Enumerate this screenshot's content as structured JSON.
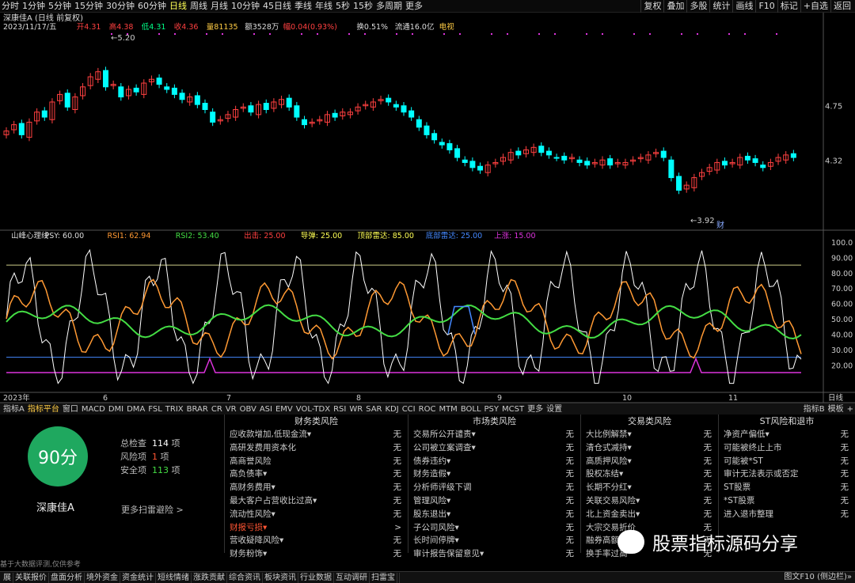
{
  "periods": [
    "分时",
    "1分钟",
    "5分钟",
    "15分钟",
    "30分钟",
    "60分钟",
    "日线",
    "周线",
    "月线",
    "10分钟",
    "45日线",
    "季线",
    "年线",
    "5秒",
    "15秒",
    "多周期",
    "更多"
  ],
  "active_period": "日线",
  "toolbar_right": [
    "复权",
    "叠加",
    "多股",
    "统计",
    "画线",
    "F10",
    "标记",
    "+自选",
    "返回"
  ],
  "stock_title": "深康佳A (日线 前复权)",
  "price_info": {
    "date": "2023/11/17/五",
    "open": "开4.31",
    "high": "高4.38",
    "low": "低4.31",
    "close": "收4.36",
    "vol": "量81135",
    "amount": "额3528万",
    "change": "幅0.04(0.93%)",
    "turnover": "换0.51%",
    "float": "流通16.0亿",
    "industry": "电视"
  },
  "price_axis": [
    "4.75",
    "4.32"
  ],
  "hi_label": "5.20",
  "lo_label": "3.92",
  "cai_label": "财",
  "indicator_header": {
    "name": "山峰心理线",
    "psy": "PSY: 60.00",
    "rsi1": "RSI1: 62.94",
    "rsi2": "RSI2: 53.40",
    "chuhuo": "出击: 25.00",
    "daoshu": "导弹: 25.00",
    "dingbu": "顶部雷达: 85.00",
    "dibu": "底部雷达: 25.00",
    "shangzhang": "上涨: 15.00"
  },
  "ind_axis": [
    "100.0",
    "90.00",
    "80.00",
    "70.00",
    "60.00",
    "50.00",
    "40.00",
    "30.00",
    "20.00"
  ],
  "date_axis": [
    "2023年",
    "6",
    "7",
    "8",
    "9",
    "10",
    "11",
    "日线"
  ],
  "tabs": [
    "指标A",
    "指标平台",
    "窗口",
    "MACD",
    "DMI",
    "DMA",
    "FSL",
    "TRIX",
    "BRAR",
    "CR",
    "VR",
    "OBV",
    "ASI",
    "EMV",
    "VOL-TDX",
    "RSI",
    "WR",
    "SAR",
    "KDJ",
    "CCI",
    "ROC",
    "MTM",
    "BOLL",
    "PSY",
    "MCST",
    "更多",
    "设置"
  ],
  "tabs_right": [
    "指标B",
    "模板",
    "+"
  ],
  "score": "90分",
  "stock_name": "深康佳A",
  "stats": {
    "total_label": "总检查",
    "total": "114",
    "total_unit": "项",
    "risk_label": "风险项",
    "risk": "1",
    "risk_unit": "项",
    "safe_label": "安全项",
    "safe": "113",
    "safe_unit": "项"
  },
  "more_scan": "更多扫雷避险 >",
  "columns": [
    {
      "title": "财务类风险",
      "rows": [
        [
          "应收款增加,低现金流▾",
          "无"
        ],
        [
          "高研发费用资本化",
          "无"
        ],
        [
          "高商誉风险",
          "无"
        ],
        [
          "高负债率▾",
          "无"
        ],
        [
          "高财务费用▾",
          "无"
        ],
        [
          "最大客户占营收比过高▾",
          "无"
        ],
        [
          "流动性风险▾",
          "无"
        ],
        [
          "财报亏损▾",
          ">"
        ],
        [
          "营收疑降风险▾",
          "无"
        ],
        [
          "财务粉饰▾",
          "无"
        ]
      ]
    },
    {
      "title": "市场类风险",
      "rows": [
        [
          "交易所公开谴责▾",
          "无"
        ],
        [
          "公司被立案调查▾",
          "无"
        ],
        [
          "债券违约▾",
          "无"
        ],
        [
          "财务造假▾",
          "无"
        ],
        [
          "分析师评级下调",
          "无"
        ],
        [
          "管理风险▾",
          "无"
        ],
        [
          "股东退出▾",
          "无"
        ],
        [
          "子公司风险▾",
          "无"
        ],
        [
          "长时间停牌▾",
          "无"
        ],
        [
          "审计报告保留意见▾",
          "无"
        ]
      ]
    },
    {
      "title": "交易类风险",
      "rows": [
        [
          "大比例解禁▾",
          "无"
        ],
        [
          "清仓式减持▾",
          "无"
        ],
        [
          "高质押风险▾",
          "无"
        ],
        [
          "股权冻结▾",
          "无"
        ],
        [
          "长期不分红▾",
          "无"
        ],
        [
          "关联交易风险▾",
          "无"
        ],
        [
          "北上资金卖出▾",
          "无"
        ],
        [
          "大宗交易折价",
          "无"
        ],
        [
          "融券高额",
          "无"
        ],
        [
          "换手率过高",
          "无"
        ]
      ]
    },
    {
      "title": "ST风险和退市",
      "rows": [
        [
          "净资产偏低▾",
          "无"
        ],
        [
          "可能被终止上市",
          "无"
        ],
        [
          "可能被*ST",
          "无"
        ],
        [
          "审计无法表示或否定",
          "无"
        ],
        [
          "ST股票",
          "无"
        ],
        [
          "*ST股票",
          "无"
        ],
        [
          "进入退市整理",
          "无"
        ]
      ]
    }
  ],
  "disclaimer": "基于大数据评测,仅供参考",
  "bottom_tabs": [
    "展",
    "关联报价",
    "盘面分析",
    "境外资金",
    "资金统计",
    "短线情绪",
    "涨跌贡献",
    "综合资讯",
    "板块资讯",
    "行业数据",
    "互动调研",
    "扫雷宝"
  ],
  "bottom_right": "图文F10 (侧边栏)»",
  "watermark": "股票指标源码分享",
  "colors": {
    "up": "#ff4040",
    "down": "#00ffff",
    "psy": "#ffffff",
    "rsi1": "#ff9933",
    "rsi2": "#44dd44",
    "top": "#cccc88",
    "bottom": "#4488ff",
    "purple": "#dd33dd"
  }
}
